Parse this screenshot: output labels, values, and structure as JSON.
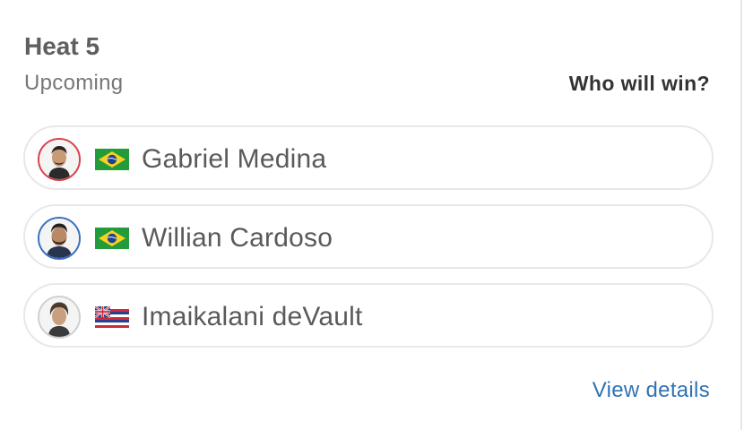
{
  "heat": {
    "title": "Heat 5",
    "status": "Upcoming",
    "prompt": "Who will win?"
  },
  "surfers": [
    {
      "name": "Gabriel Medina",
      "country_flag": "brazil-flag-icon",
      "ring_color": "#d9424a"
    },
    {
      "name": "Willian Cardoso",
      "country_flag": "brazil-flag-icon",
      "ring_color": "#3a6fc2"
    },
    {
      "name": "Imaikalani deVault",
      "country_flag": "hawaii-flag-icon",
      "ring_color": "#d0d0d0"
    }
  ],
  "footer": {
    "view_details": "View details"
  },
  "colors": {
    "link": "#2f73b5",
    "row_border": "#e8e8e8"
  }
}
